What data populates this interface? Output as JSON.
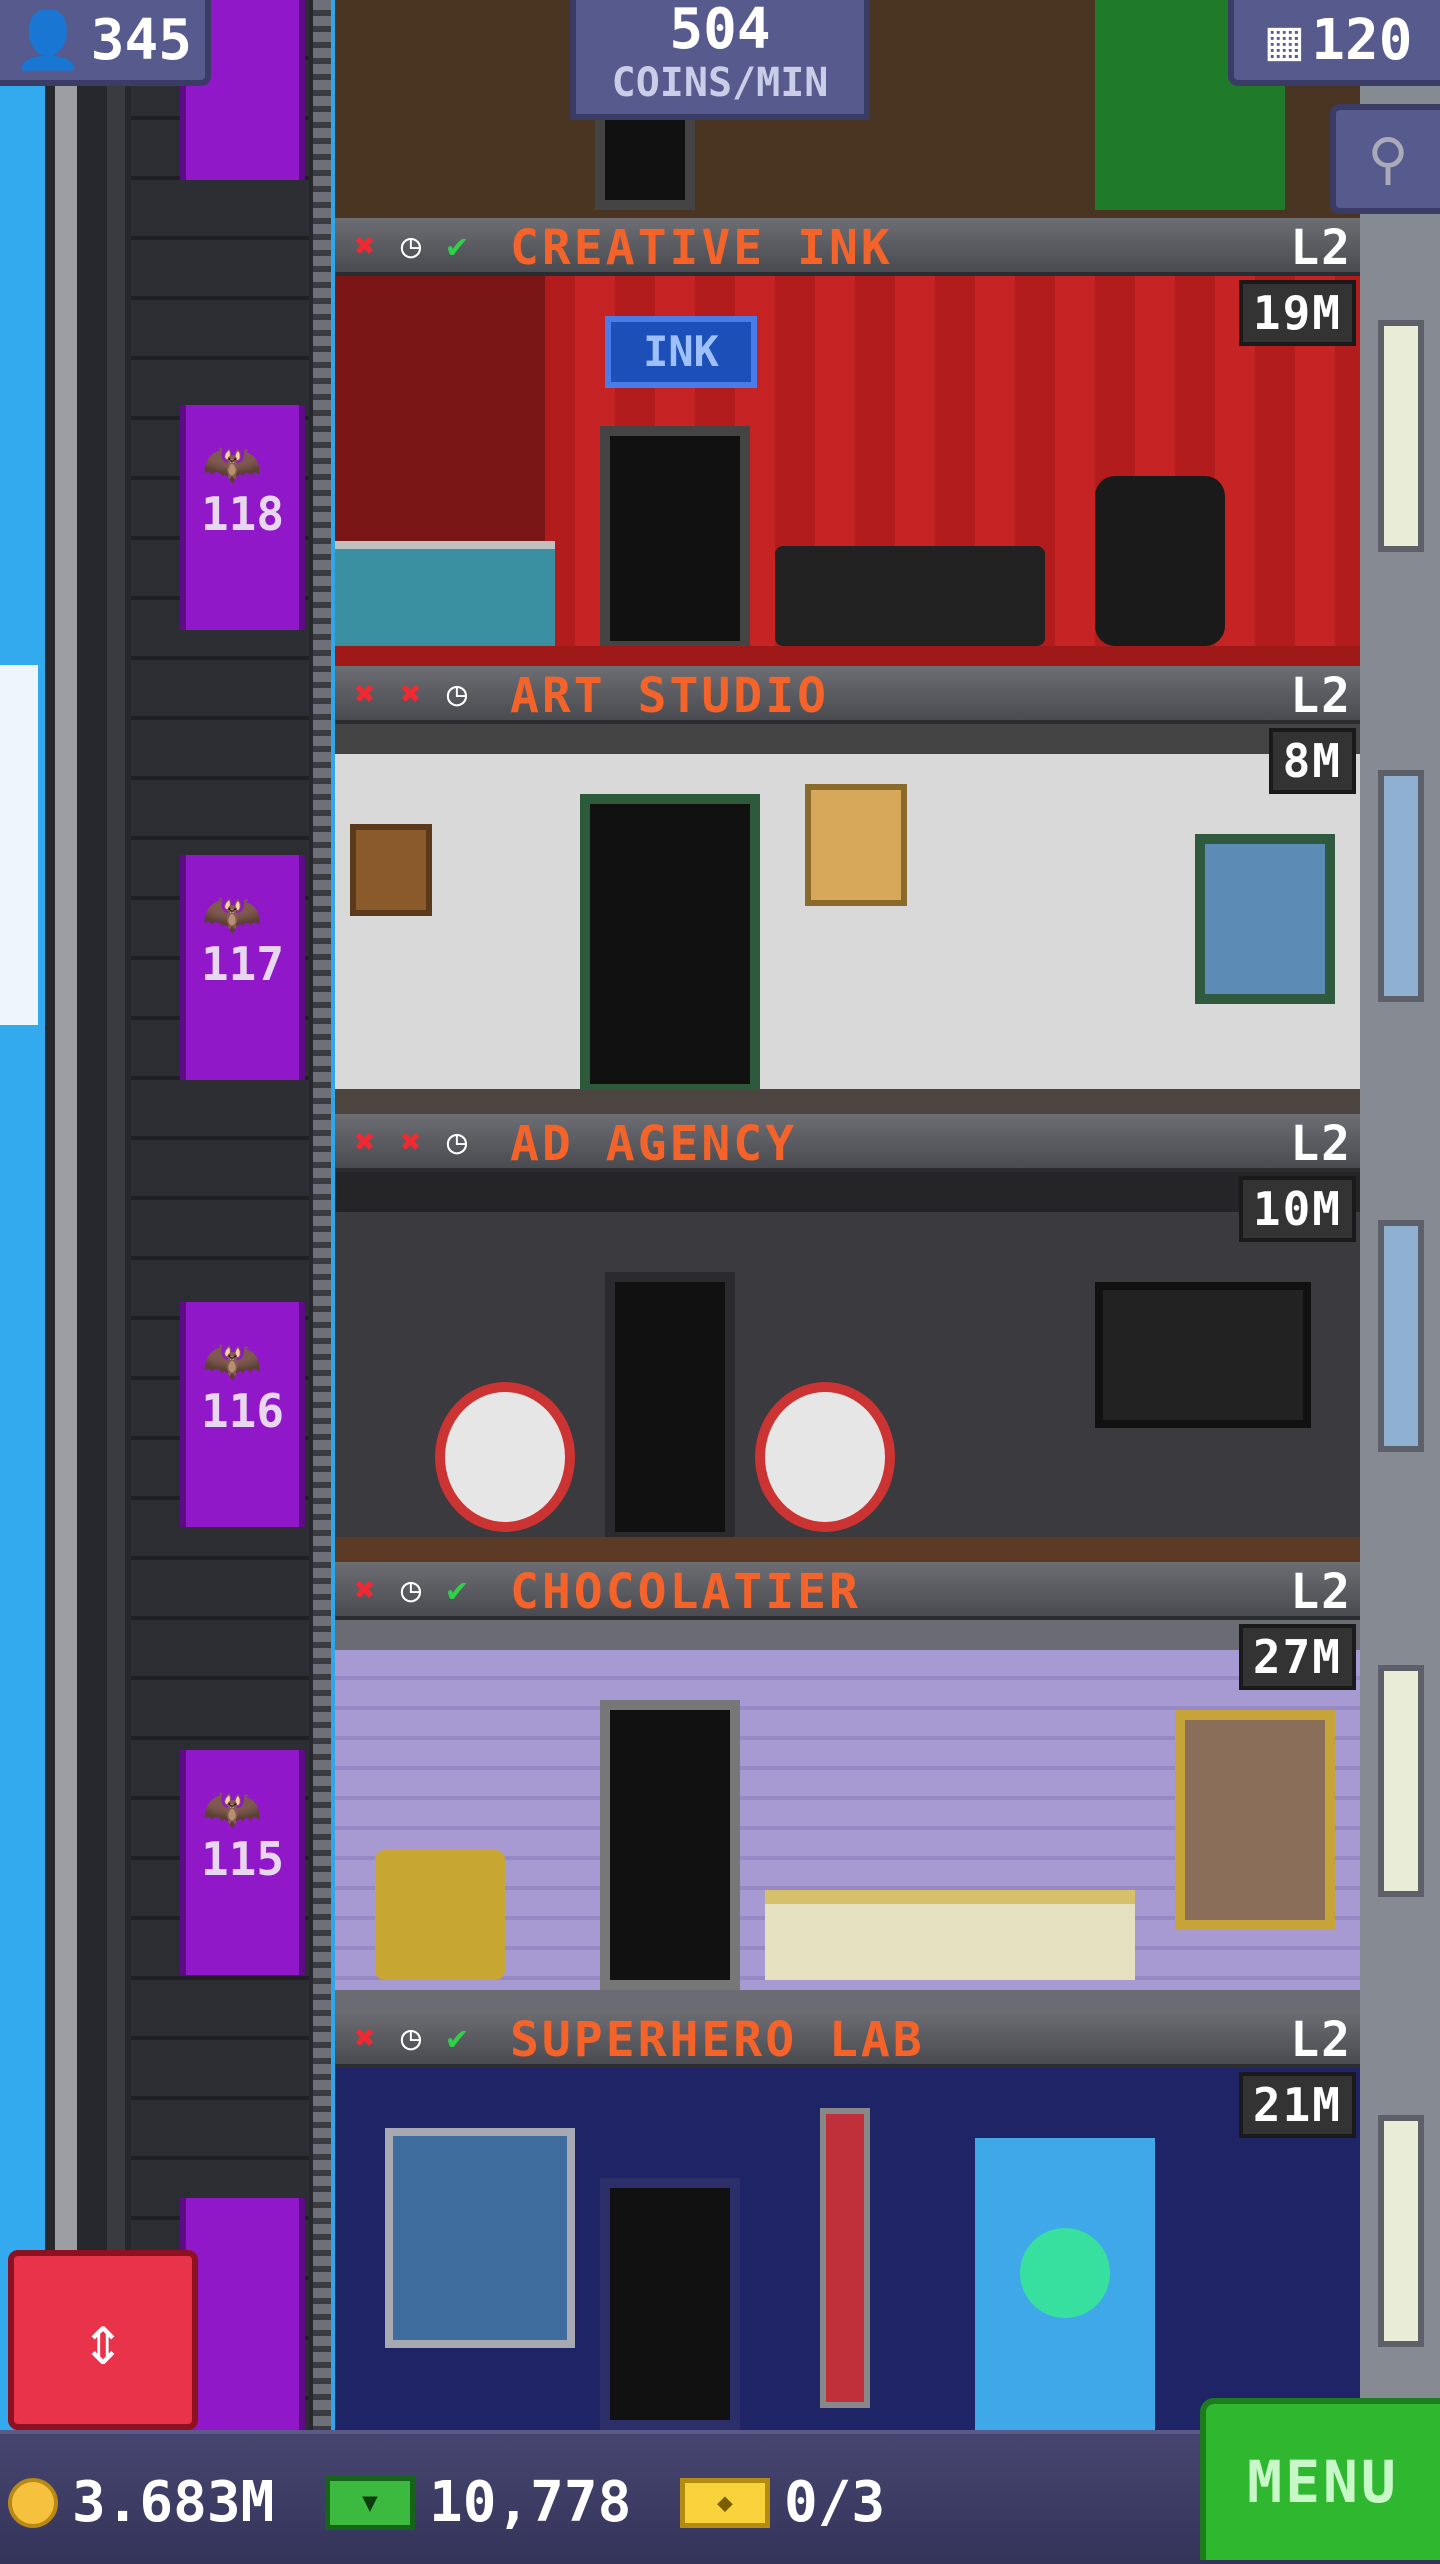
{
  "hud": {
    "population": "345",
    "coins_per_min_value": "504",
    "coins_per_min_label": "COINS/MIN",
    "floor_count": "120"
  },
  "lobby_floor_numbers": [
    "118",
    "117",
    "116",
    "115"
  ],
  "floors": [
    {
      "name": "CREATIVE INK",
      "level": "L2",
      "stock": "19M",
      "status_icons": [
        "x",
        "clock",
        "check"
      ],
      "wall_color": "#c42222",
      "floor_color": "#b82828",
      "sign": "INK"
    },
    {
      "name": "ART STUDIO",
      "level": "L2",
      "stock": "8M",
      "status_icons": [
        "x",
        "x",
        "clock"
      ],
      "wall_color": "#d8d8d8",
      "floor_color": "#4d4640"
    },
    {
      "name": "AD AGENCY",
      "level": "L2",
      "stock": "10M",
      "status_icons": [
        "x",
        "x",
        "clock"
      ],
      "wall_color": "#3a3a3f",
      "floor_color": "#5b3b26"
    },
    {
      "name": "CHOCOLATIER",
      "level": "L2",
      "stock": "27M",
      "status_icons": [
        "x",
        "clock",
        "check"
      ],
      "wall_color": "#a79ad2",
      "floor_color": "#6b6b73"
    },
    {
      "name": "SUPERHERO LAB",
      "level": "L2",
      "stock": "21M",
      "status_icons": [
        "x",
        "clock",
        "check"
      ],
      "wall_color": "#1f2466",
      "floor_color": "#2a2a55"
    }
  ],
  "bottom_bar": {
    "coins": "3.683M",
    "bux": "10,778",
    "tickets": "0/3",
    "menu_label": "MENU"
  },
  "icons": {
    "population": "person-icon",
    "floors": "building-icon",
    "search": "magnifier-icon",
    "elevator": "up-down-arrows-icon",
    "coin": "coin-icon",
    "bux": "bux-icon",
    "ticket": "ticket-icon"
  }
}
